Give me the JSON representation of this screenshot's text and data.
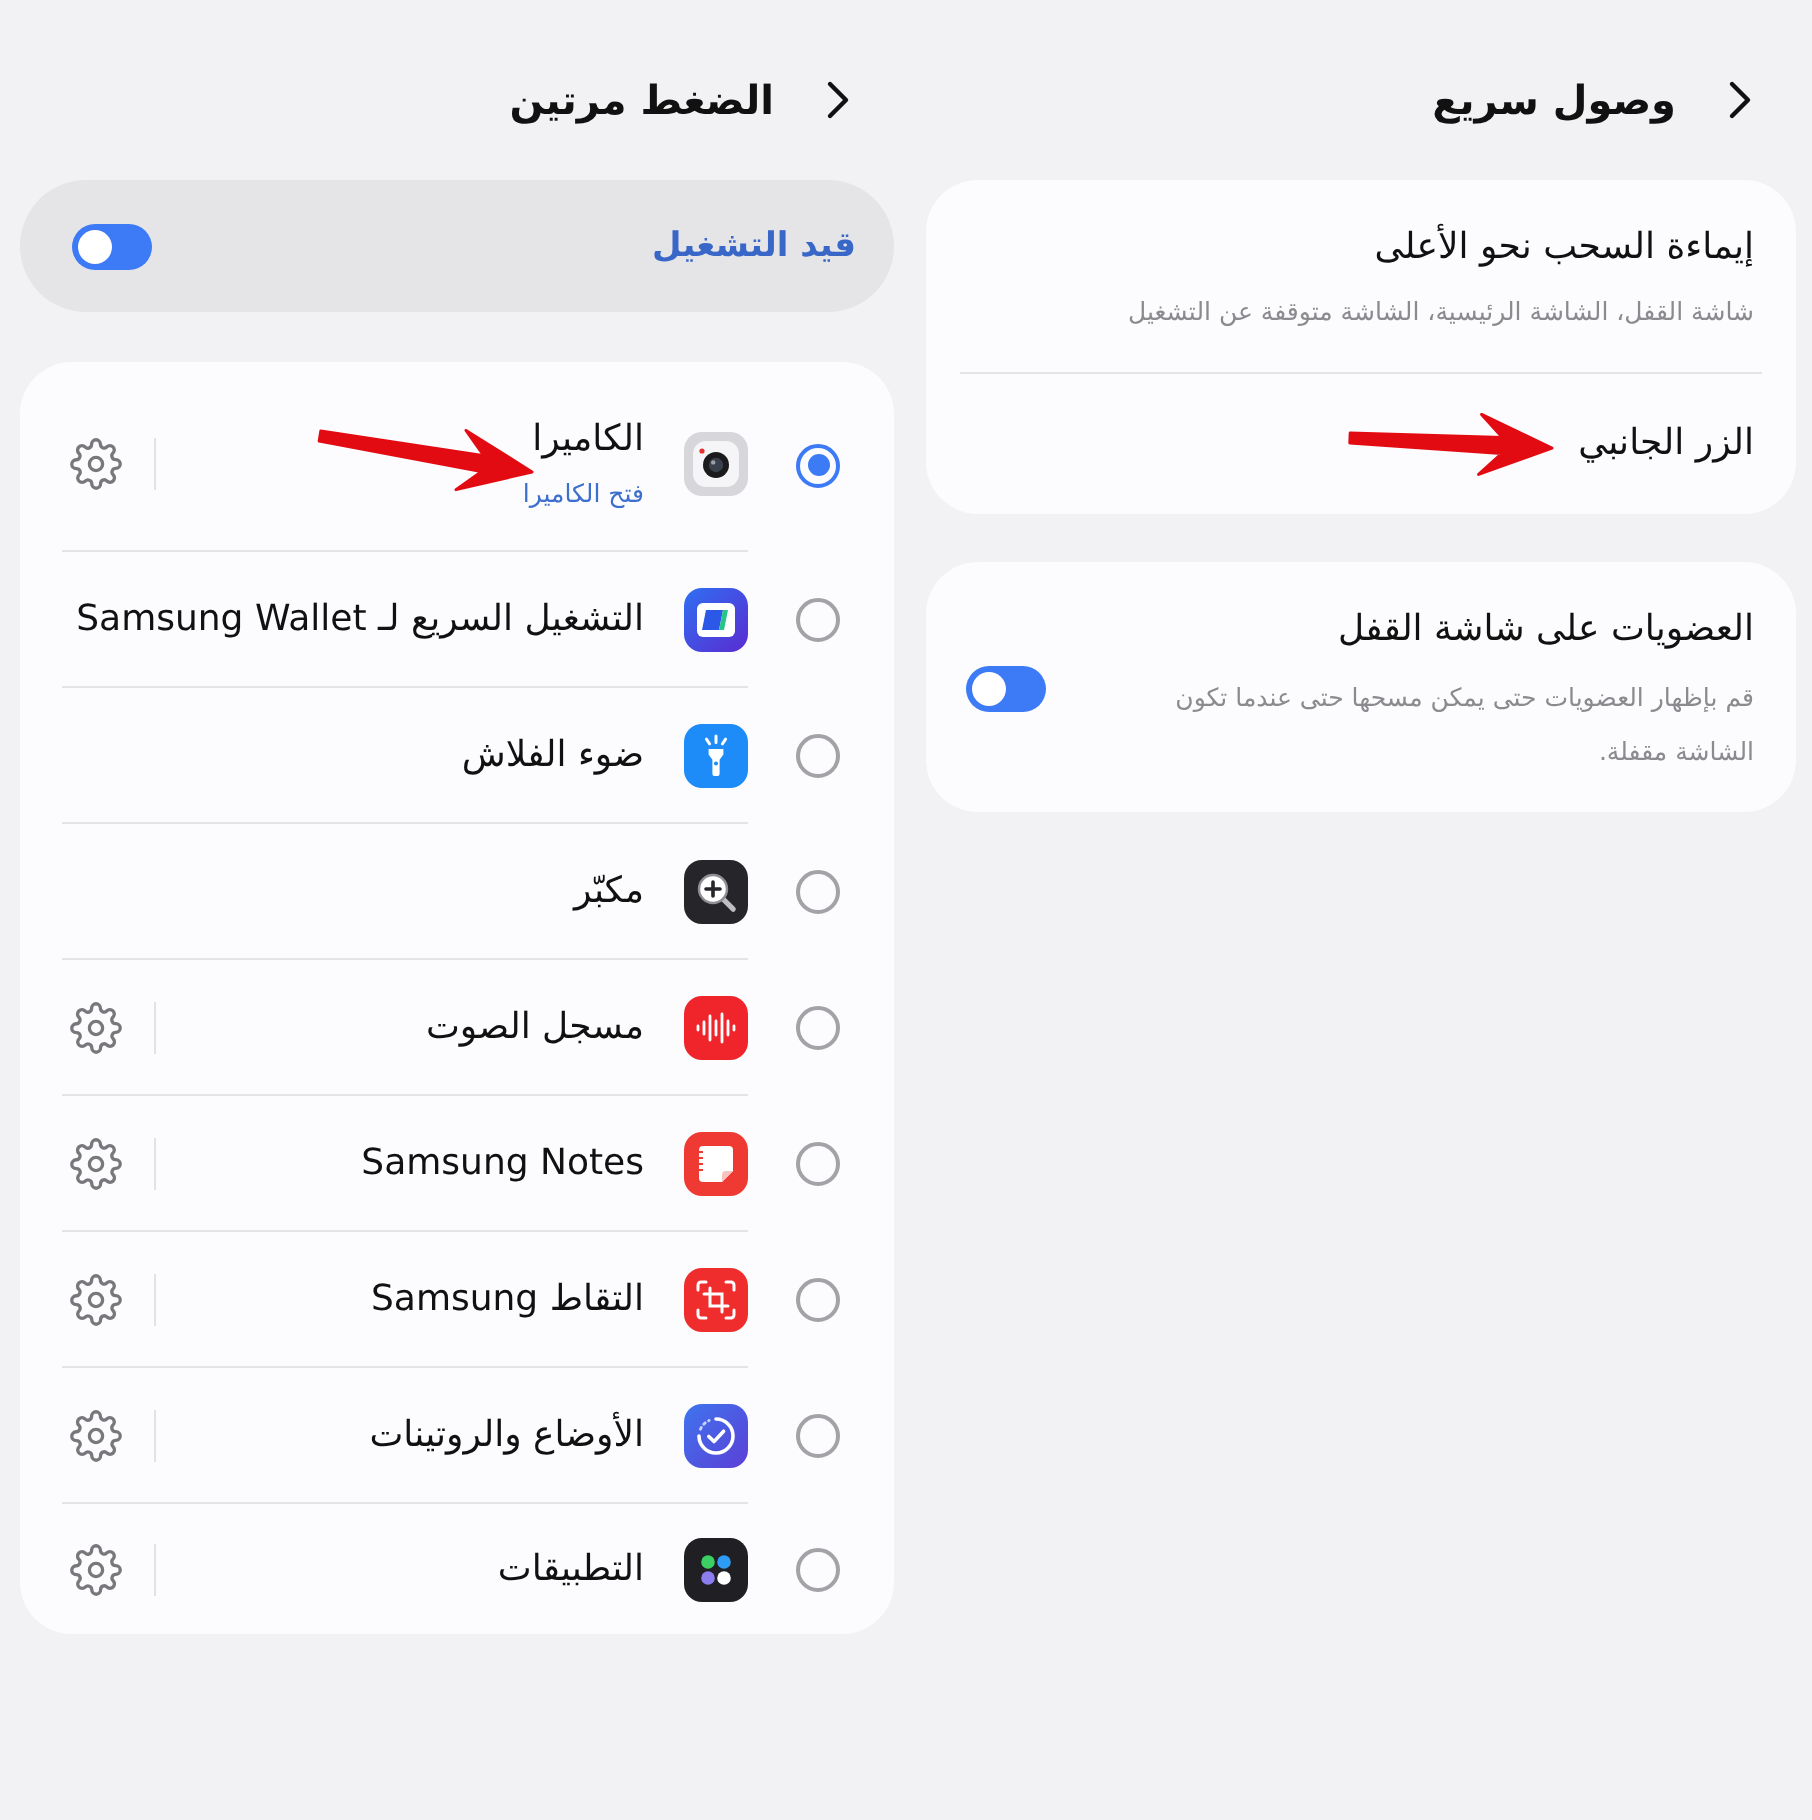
{
  "quick_access": {
    "title": "وصول سريع",
    "cards": [
      {
        "items": [
          {
            "kind": "link",
            "title": "إيماءة السحب نحو الأعلى",
            "subtitle": "شاشة القفل، الشاشة الرئيسية، الشاشة متوقفة عن التشغيل",
            "arrow": false
          },
          {
            "kind": "link",
            "title": "الزر الجانبي",
            "arrow": true
          }
        ]
      },
      {
        "items": [
          {
            "kind": "switch",
            "title": "العضويات على شاشة القفل",
            "subtitle": "قم بإظهار العضويات حتى يمكن مسحها حتى عندما تكون الشاشة مقفلة.",
            "on": true,
            "arrow": false
          }
        ]
      }
    ]
  },
  "double_press": {
    "title": "الضغط مرتين",
    "master_switch": {
      "label": "قيد التشغيل",
      "on": true
    },
    "options": [
      {
        "label": "الكاميرا",
        "subtitle": "فتح الكاميرا",
        "selected": true,
        "settings": true,
        "arrow": true
      },
      {
        "label": "التشغيل السريع لـ Samsung Wallet",
        "selected": false,
        "settings": false,
        "arrow": false
      },
      {
        "label": "ضوء الفلاش",
        "selected": false,
        "settings": false,
        "arrow": false
      },
      {
        "label": "مكبّر",
        "selected": false,
        "settings": false,
        "arrow": false
      },
      {
        "label": "مسجل الصوت",
        "selected": false,
        "settings": true,
        "arrow": false
      },
      {
        "label": "Samsung Notes",
        "selected": false,
        "settings": true,
        "arrow": false
      },
      {
        "label": "التقاط Samsung",
        "selected": false,
        "settings": true,
        "arrow": false
      },
      {
        "label": "الأوضاع والروتينات",
        "selected": false,
        "settings": true,
        "arrow": false
      },
      {
        "label": "التطبيقات",
        "selected": false,
        "settings": true,
        "arrow": false
      }
    ]
  }
}
